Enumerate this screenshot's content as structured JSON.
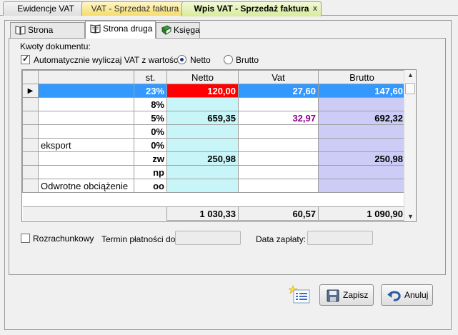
{
  "doc_tabs": [
    {
      "label": "Ewidencje VAT"
    },
    {
      "label": "VAT - Sprzedaż faktura"
    },
    {
      "label": "Wpis VAT - Sprzedaż faktura",
      "close": "x"
    }
  ],
  "inner_tabs": [
    {
      "label": "Strona pierwsza",
      "icon": "book-icon"
    },
    {
      "label": "Strona druga",
      "icon": "book-open-icon"
    },
    {
      "label": "Księga",
      "icon": "green-book-icon"
    }
  ],
  "group": {
    "title": "Kwoty dokumentu:",
    "auto_vat_label": "Automatycznie wyliczaj VAT z wartości:",
    "auto_vat_checked": true,
    "radio_netto": "Netto",
    "radio_brutto": "Brutto",
    "selected": "Netto"
  },
  "grid": {
    "headers": {
      "desc": "",
      "rate": "st.",
      "netto": "Netto",
      "vat": "Vat",
      "brutto": "Brutto"
    },
    "rows": [
      {
        "desc": "",
        "rate": "23%",
        "netto": "120,00",
        "vat": "27,60",
        "brutto": "147,60"
      },
      {
        "desc": "",
        "rate": "8%",
        "netto": "",
        "vat": "",
        "brutto": ""
      },
      {
        "desc": "",
        "rate": "5%",
        "netto": "659,35",
        "vat": "32,97",
        "brutto": "692,32"
      },
      {
        "desc": "",
        "rate": "0%",
        "netto": "",
        "vat": "",
        "brutto": ""
      },
      {
        "desc": "eksport",
        "rate": "0%",
        "netto": "",
        "vat": "",
        "brutto": ""
      },
      {
        "desc": "",
        "rate": "zw",
        "netto": "250,98",
        "vat": "",
        "brutto": "250,98"
      },
      {
        "desc": "",
        "rate": "np",
        "netto": "",
        "vat": "",
        "brutto": ""
      },
      {
        "desc": "Odwrotne obciążenie",
        "rate": "oo",
        "netto": "",
        "vat": "",
        "brutto": ""
      }
    ],
    "totals": {
      "netto": "1 030,33",
      "vat": "60,57",
      "brutto": "1 090,90"
    }
  },
  "footer": {
    "rozrachunkowy_label": "Rozrachunkowy",
    "termin_label": "Termin płatności do:",
    "data_zaplaty_label": "Data zapłaty:"
  },
  "buttons": {
    "zapisz": "Zapisz",
    "anuluj": "Anuluj"
  }
}
